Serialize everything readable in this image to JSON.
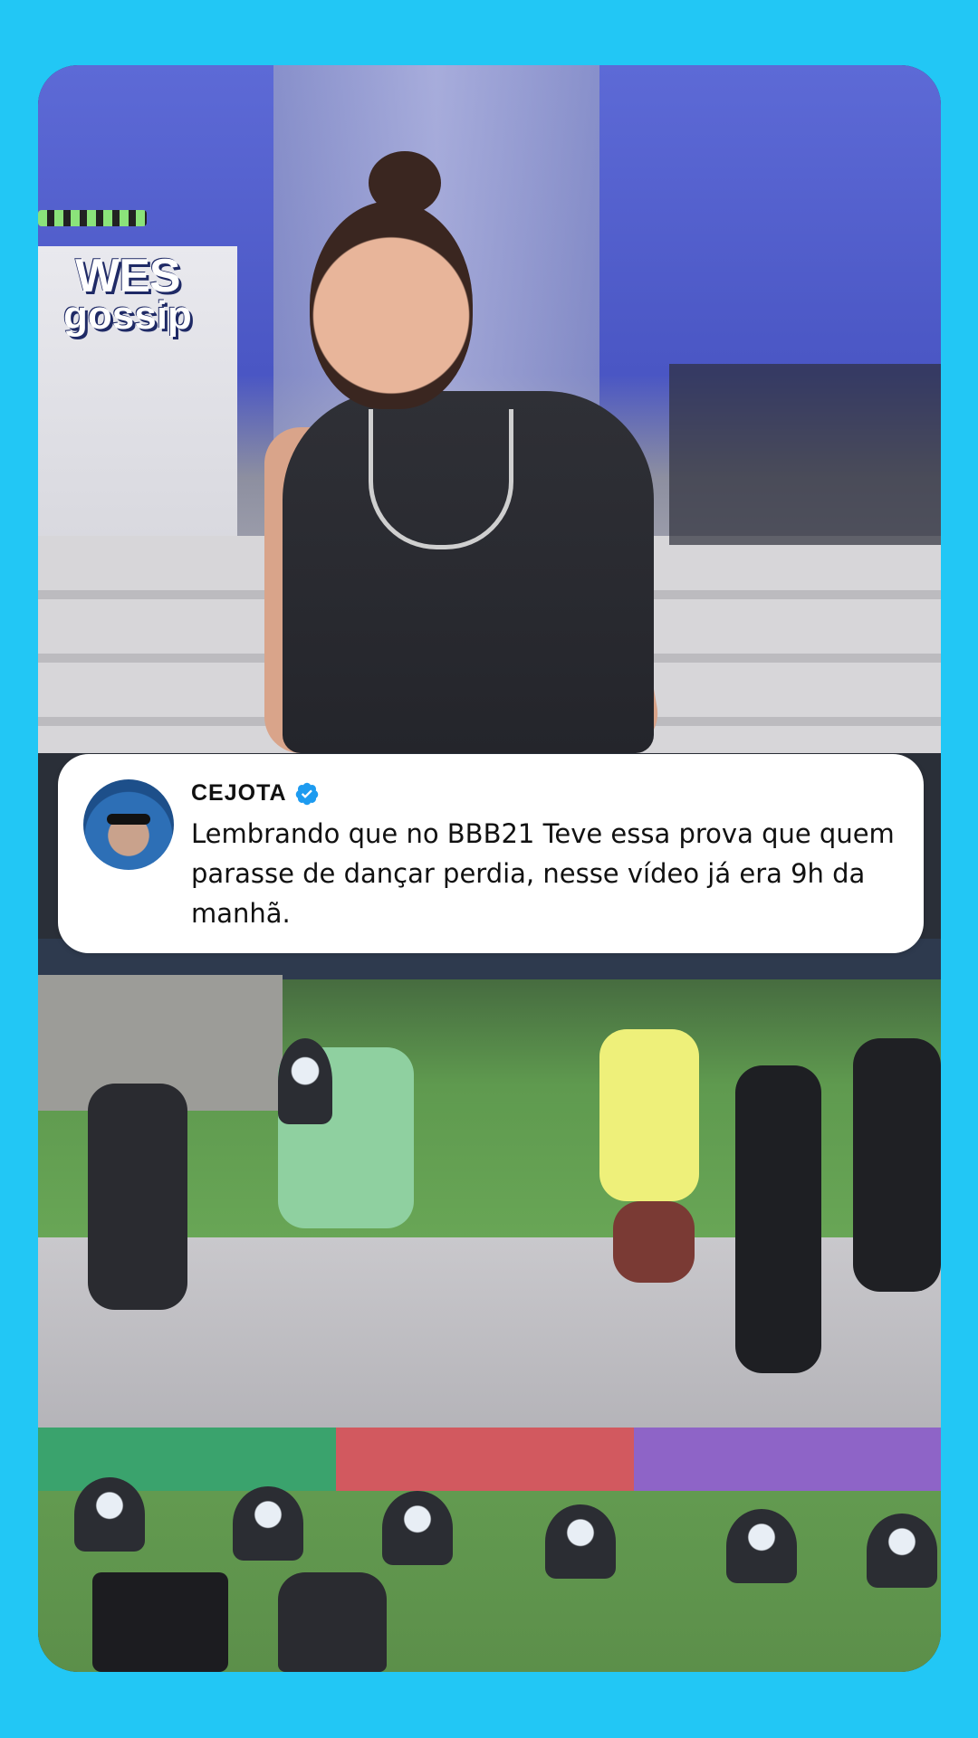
{
  "brand": {
    "watermark_line1": "WES",
    "watermark_line2": "gossip",
    "background_color": "#22C7F5"
  },
  "post": {
    "author_name": "CEJOTA",
    "verified": true,
    "verified_icon": "verified-badge-icon",
    "text": "Lembrando que no BBB21 Teve essa prova que quem parasse de dançar perdia, nesse vídeo já era 9h da manhã."
  },
  "media": {
    "top_image": "woman-dancing-photo",
    "bottom_image": "group-dancing-on-stage-photo"
  }
}
